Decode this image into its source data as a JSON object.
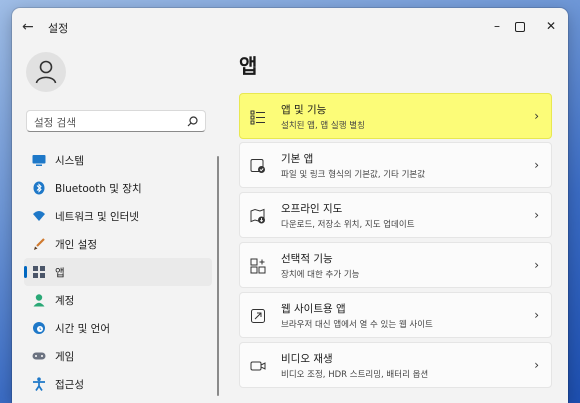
{
  "window": {
    "title": "설정",
    "back_icon": "back-arrow-icon",
    "minimize_icon": "minimize-icon",
    "maximize_icon": "maximize-icon",
    "close_icon": "close-icon"
  },
  "search": {
    "placeholder": "설정 검색",
    "icon": "search-icon"
  },
  "sidebar": {
    "items": [
      {
        "label": "시스템",
        "icon": "monitor-icon",
        "color": "#1e78c8",
        "active": false
      },
      {
        "label": "Bluetooth 및 장치",
        "icon": "bluetooth-icon",
        "color": "#1e78c8",
        "active": false
      },
      {
        "label": "네트워크 및 인터넷",
        "icon": "wifi-icon",
        "color": "#1e78c8",
        "active": false
      },
      {
        "label": "개인 설정",
        "icon": "brush-icon",
        "color": "#d07a30",
        "active": false
      },
      {
        "label": "앱",
        "icon": "apps-icon",
        "color": "#4a5568",
        "active": true
      },
      {
        "label": "계정",
        "icon": "account-icon",
        "color": "#2aa876",
        "active": false
      },
      {
        "label": "시간 및 언어",
        "icon": "globe-clock-icon",
        "color": "#1e78c8",
        "active": false
      },
      {
        "label": "게임",
        "icon": "gamepad-icon",
        "color": "#6b7280",
        "active": false
      },
      {
        "label": "접근성",
        "icon": "accessibility-icon",
        "color": "#1e78c8",
        "active": false
      }
    ]
  },
  "main": {
    "title": "앱",
    "cards": [
      {
        "title": "앱 및 기능",
        "subtitle": "설치된 앱, 앱 실행 별칭",
        "icon": "apps-features-icon",
        "highlight": true
      },
      {
        "title": "기본 앱",
        "subtitle": "파일 및 링크 형식의 기본값, 기타 기본값",
        "icon": "default-apps-icon",
        "highlight": false
      },
      {
        "title": "오프라인 지도",
        "subtitle": "다운로드, 저장소 위치, 지도 업데이트",
        "icon": "offline-maps-icon",
        "highlight": false
      },
      {
        "title": "선택적 기능",
        "subtitle": "장치에 대한 추가 기능",
        "icon": "optional-features-icon",
        "highlight": false
      },
      {
        "title": "웹 사이트용 앱",
        "subtitle": "브라우저 대신 앱에서 열 수 있는 웹 사이트",
        "icon": "apps-for-websites-icon",
        "highlight": false
      },
      {
        "title": "비디오 재생",
        "subtitle": "비디오 조정, HDR 스트리밍, 배터리 옵션",
        "icon": "video-playback-icon",
        "highlight": false
      }
    ]
  },
  "colors": {
    "accent": "#0067c0",
    "highlight": "#fcfc78"
  }
}
